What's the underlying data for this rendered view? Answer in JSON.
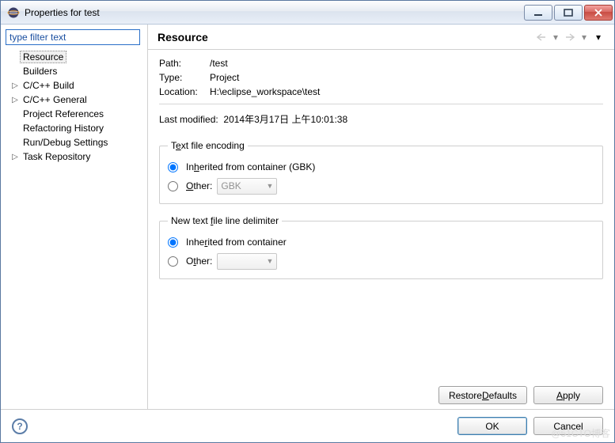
{
  "window": {
    "title": "Properties for test"
  },
  "sidebar": {
    "filter_placeholder": "type filter text",
    "items": [
      {
        "label": "Resource",
        "expandable": false,
        "selected": true
      },
      {
        "label": "Builders",
        "expandable": false,
        "selected": false
      },
      {
        "label": "C/C++ Build",
        "expandable": true,
        "selected": false
      },
      {
        "label": "C/C++ General",
        "expandable": true,
        "selected": false
      },
      {
        "label": "Project References",
        "expandable": false,
        "selected": false
      },
      {
        "label": "Refactoring History",
        "expandable": false,
        "selected": false
      },
      {
        "label": "Run/Debug Settings",
        "expandable": false,
        "selected": false
      },
      {
        "label": "Task Repository",
        "expandable": true,
        "selected": false
      }
    ]
  },
  "page": {
    "title": "Resource",
    "path_label": "Path:",
    "path_value": "/test",
    "type_label": "Type:",
    "type_value": "Project",
    "location_label": "Location:",
    "location_value": "H:\\eclipse_workspace\\test",
    "lastmod_label": "Last modified:",
    "lastmod_value": "2014年3月17日 上午10:01:38",
    "encoding": {
      "legend_pre": "T",
      "legend_u": "e",
      "legend_post": "xt file encoding",
      "inherited_pre": "In",
      "inherited_u": "h",
      "inherited_post": "erited from container (GBK)",
      "other_pre": "",
      "other_u": "O",
      "other_post": "ther:",
      "other_value": "GBK"
    },
    "delimiter": {
      "legend_pre": "New text ",
      "legend_u": "f",
      "legend_post": "ile line delimiter",
      "inherited_pre": "Inhe",
      "inherited_u": "r",
      "inherited_post": "ited from container",
      "other_pre": "O",
      "other_u": "t",
      "other_post": "her:",
      "other_value": ""
    },
    "restore_pre": "Restore ",
    "restore_u": "D",
    "restore_post": "efaults",
    "apply_u": "A",
    "apply_post": "pply"
  },
  "footer": {
    "ok": "OK",
    "cancel": "Cancel"
  },
  "watermark": "@51CTO博客"
}
